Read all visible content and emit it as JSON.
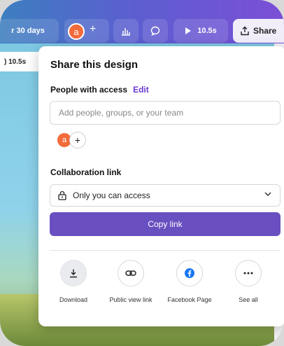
{
  "toolbar": {
    "trial_text": "r 30 days",
    "avatar_initial": "a",
    "add_symbol": "+",
    "chart_icon": "bar-chart-icon",
    "comment_icon": "comment-icon",
    "play_duration": "10.5s",
    "share_label": "Share"
  },
  "canvas": {
    "timer_label": ") 10.5s"
  },
  "share_panel": {
    "title": "Share this design",
    "people_label": "People with access",
    "edit_label": "Edit",
    "add_placeholder": "Add people, groups, or your team",
    "member_initial": "a",
    "add_member_symbol": "+",
    "collab_label": "Collaboration link",
    "access_option": "Only you can access",
    "copy_label": "Copy link",
    "actions": [
      {
        "label": "Download",
        "icon": "download-icon"
      },
      {
        "label": "Public view link",
        "icon": "link-icon"
      },
      {
        "label": "Facebook Page",
        "icon": "facebook-icon"
      },
      {
        "label": "See all",
        "icon": "more-icon"
      }
    ]
  }
}
